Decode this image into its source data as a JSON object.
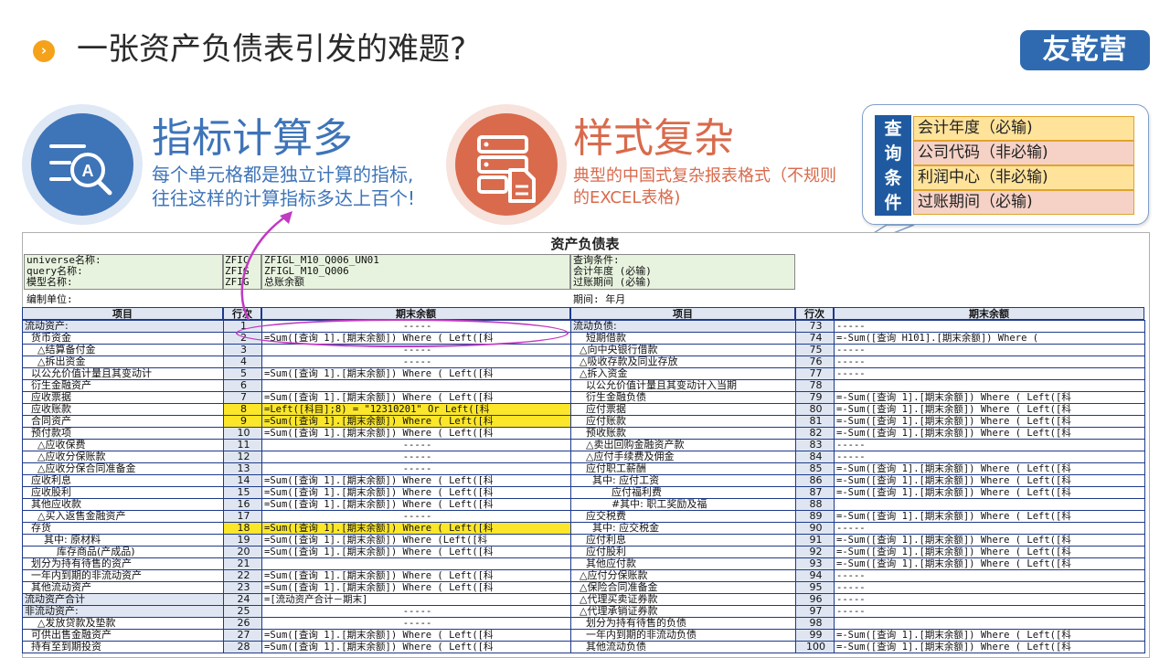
{
  "header": {
    "bullet": "›",
    "title": "一张资产负债表引发的难题?",
    "logo": "友乾营"
  },
  "features": [
    {
      "title": "指标计算多",
      "desc_lines": [
        "每个单元格都是独立计算的指标,",
        "往往这样的计算指标多达上百个!"
      ],
      "icon": "document-search-icon"
    },
    {
      "title": "样式复杂",
      "desc": "典型的中国式复杂报表格式（不规则的EXCEL表格)",
      "icon": "server-document-icon"
    }
  ],
  "query_panel": {
    "head": [
      "查",
      "询",
      "条",
      "件"
    ],
    "conditions": [
      "会计年度（必输)",
      "公司代码（非必输)",
      "利润中心（非必输)",
      "过账期间（必输)"
    ]
  },
  "sheet": {
    "title": "资产负债表",
    "info": {
      "universe_label": "universe名称:",
      "universe_short": "ZFIC",
      "universe_value": "ZFIGL_M10_Q006_UN01",
      "query_label": "query名称:",
      "query_short": "ZFIG",
      "query_value": "ZFIGL_M10_Q006",
      "model_label": "模型名称:",
      "model_short": "ZFIG",
      "model_value": "总账余额",
      "cond_title": "查询条件:",
      "cond_year": "会计年度 (必输)",
      "cond_period": "过账期间 (必输)",
      "unit_label": "编制单位:",
      "period_label": "期间: 年月"
    },
    "headers": {
      "item": "项目",
      "line": "行次",
      "balance": "期末余额"
    },
    "left_rows": [
      {
        "item": "流动资产:",
        "no": "1",
        "val": "-----",
        "dash": true,
        "lbl": true
      },
      {
        "item": "  货币资金",
        "no": "2",
        "val": "=Sum([查询 1].[期末余额]) Where ( Left([科"
      },
      {
        "item": "    △结算备付金",
        "no": "3",
        "val": "-----",
        "dash": true
      },
      {
        "item": "    △拆出资金",
        "no": "4",
        "val": "-----",
        "dash": true
      },
      {
        "item": "  以公允价值计量且其变动计",
        "no": "5",
        "val": "=Sum([查询 1].[期末余额]) Where ( Left([科"
      },
      {
        "item": "  衍生金融资产",
        "no": "6",
        "val": ""
      },
      {
        "item": "  应收票据",
        "no": "7",
        "val": "=Sum([查询 1].[期末余额]) Where ( Left([科"
      },
      {
        "item": "  应收账款",
        "no": "8",
        "val": "=Left([科目];8) = \"12310201\"  Or Left([科",
        "hl": true
      },
      {
        "item": "  合同资产",
        "no": "9",
        "val": "=Sum([查询 1].[期末余额]) Where ( Left([科",
        "hl": true
      },
      {
        "item": "  预付款项",
        "no": "10",
        "val": "=Sum([查询 1].[期末余额]) Where ( Left([科"
      },
      {
        "item": "    △应收保费",
        "no": "11",
        "val": "-----",
        "dash": true
      },
      {
        "item": "    △应收分保账款",
        "no": "12",
        "val": "-----",
        "dash": true
      },
      {
        "item": "    △应收分保合同准备金",
        "no": "13",
        "val": "-----",
        "dash": true
      },
      {
        "item": "  应收利息",
        "no": "14",
        "val": "=Sum([查询 1].[期末余额]) Where ( Left([科"
      },
      {
        "item": "  应收股利",
        "no": "15",
        "val": "=Sum([查询 1].[期末余额]) Where ( Left([科"
      },
      {
        "item": "  其他应收款",
        "no": "16",
        "val": "=Sum([查询 1].[期末余额]) Where ( Left([科"
      },
      {
        "item": "    △买入返售金融资产",
        "no": "17",
        "val": "-----",
        "dash": true
      },
      {
        "item": "  存货",
        "no": "18",
        "val": "=Sum([查询 1].[期末余额]) Where ( Left([科",
        "hl": true
      },
      {
        "item": "      其中: 原材料",
        "no": "19",
        "val": "=Sum([查询 1].[期末余额]) Where (Left([科"
      },
      {
        "item": "          库存商品(产成品)",
        "no": "20",
        "val": "=Sum([查询 1].[期末余额]) Where (  Left([科"
      },
      {
        "item": "  划分为持有待售的资产",
        "no": "21",
        "val": ""
      },
      {
        "item": "  一年内到期的非流动资产",
        "no": "22",
        "val": "=Sum([查询 1].[期末余额])  Where ( Left([科"
      },
      {
        "item": "  其他流动资产",
        "no": "23",
        "val": "=Sum([查询 1].[期末余额]) Where ( Left([科"
      },
      {
        "item": "流动资产合计",
        "no": "24",
        "val": "=[流动资产合计－期末]",
        "lbl": true
      },
      {
        "item": "非流动资产:",
        "no": "25",
        "val": "-----",
        "dash": true,
        "lbl": true
      },
      {
        "item": "    △发放贷款及垫款",
        "no": "26",
        "val": "-----",
        "dash": true
      },
      {
        "item": "  可供出售金融资产",
        "no": "27",
        "val": "=Sum([查询 1].[期末余额]) Where ( Left([科"
      },
      {
        "item": "  持有至到期投资",
        "no": "28",
        "val": "=Sum([查询 1].[期末余额]) Where ( Left([科"
      }
    ],
    "right_rows": [
      {
        "item": "流动负债:",
        "no": "73",
        "val": "-----",
        "lbl": true
      },
      {
        "item": "    短期借款",
        "no": "74",
        "val": "=-Sum([查询 H101].[期末余额]) Where ("
      },
      {
        "item": "  △向中央银行借款",
        "no": "75",
        "val": "-----"
      },
      {
        "item": "  △吸收存款及同业存放",
        "no": "76",
        "val": "-----"
      },
      {
        "item": "  △拆入资金",
        "no": "77",
        "val": "-----"
      },
      {
        "item": "    以公允价值计量且其变动计入当期",
        "no": "78",
        "val": ""
      },
      {
        "item": "    衍生金融负债",
        "no": "79",
        "val": "=-Sum([查询 1].[期末余额]) Where ( Left([科"
      },
      {
        "item": "    应付票据",
        "no": "80",
        "val": "=-Sum([查询 1].[期末余额]) Where ( Left([科"
      },
      {
        "item": "    应付账款",
        "no": "81",
        "val": "=-Sum([查询 1].[期末余额]) Where ( Left([科"
      },
      {
        "item": "    预收账款",
        "no": "82",
        "val": "=-Sum([查询 1].[期末余额]) Where ( Left([科"
      },
      {
        "item": "    △卖出回购金融资产款",
        "no": "83",
        "val": "-----"
      },
      {
        "item": "    △应付手续费及佣金",
        "no": "84",
        "val": "-----"
      },
      {
        "item": "    应付职工薪酬",
        "no": "85",
        "val": "=-Sum([查询 1].[期末余额]) Where ( Left([科"
      },
      {
        "item": "      其中: 应付工资",
        "no": "86",
        "val": "=-Sum([查询 1].[期末余额]) Where ( Left([科"
      },
      {
        "item": "            应付福利费",
        "no": "87",
        "val": "=-Sum([查询 1].[期末余额]) Where ( Left([科"
      },
      {
        "item": "            #其中: 职工奖励及福",
        "no": "88",
        "val": ""
      },
      {
        "item": "    应交税费",
        "no": "89",
        "val": "=-Sum([查询 1].[期末余额]) Where ( Left([科"
      },
      {
        "item": "      其中: 应交税金",
        "no": "90",
        "val": "-----"
      },
      {
        "item": "    应付利息",
        "no": "91",
        "val": "=-Sum([查询 1].[期末余额]) Where ( Left([科"
      },
      {
        "item": "    应付股利",
        "no": "92",
        "val": "=-Sum([查询 1].[期末余额]) Where ( Left([科"
      },
      {
        "item": "    其他应付款",
        "no": "93",
        "val": "=-Sum([查询 1].[期末余额]) Where ( Left([科"
      },
      {
        "item": "  △应付分保账款",
        "no": "94",
        "val": "-----"
      },
      {
        "item": "  △保险合同准备金",
        "no": "95",
        "val": "-----"
      },
      {
        "item": "  △代理买卖证券款",
        "no": "96",
        "val": "-----"
      },
      {
        "item": "  △代理承销证券款",
        "no": "97",
        "val": "-----"
      },
      {
        "item": "    划分为持有待售的负债",
        "no": "98",
        "val": ""
      },
      {
        "item": "    一年内到期的非流动负债",
        "no": "99",
        "val": "=-Sum([查询 1].[期末余额]) Where ( Left([科"
      },
      {
        "item": "    其他流动负债",
        "no": "100",
        "val": "=-Sum([查询 1].[期末余额]) Where ( Left([科"
      }
    ]
  }
}
